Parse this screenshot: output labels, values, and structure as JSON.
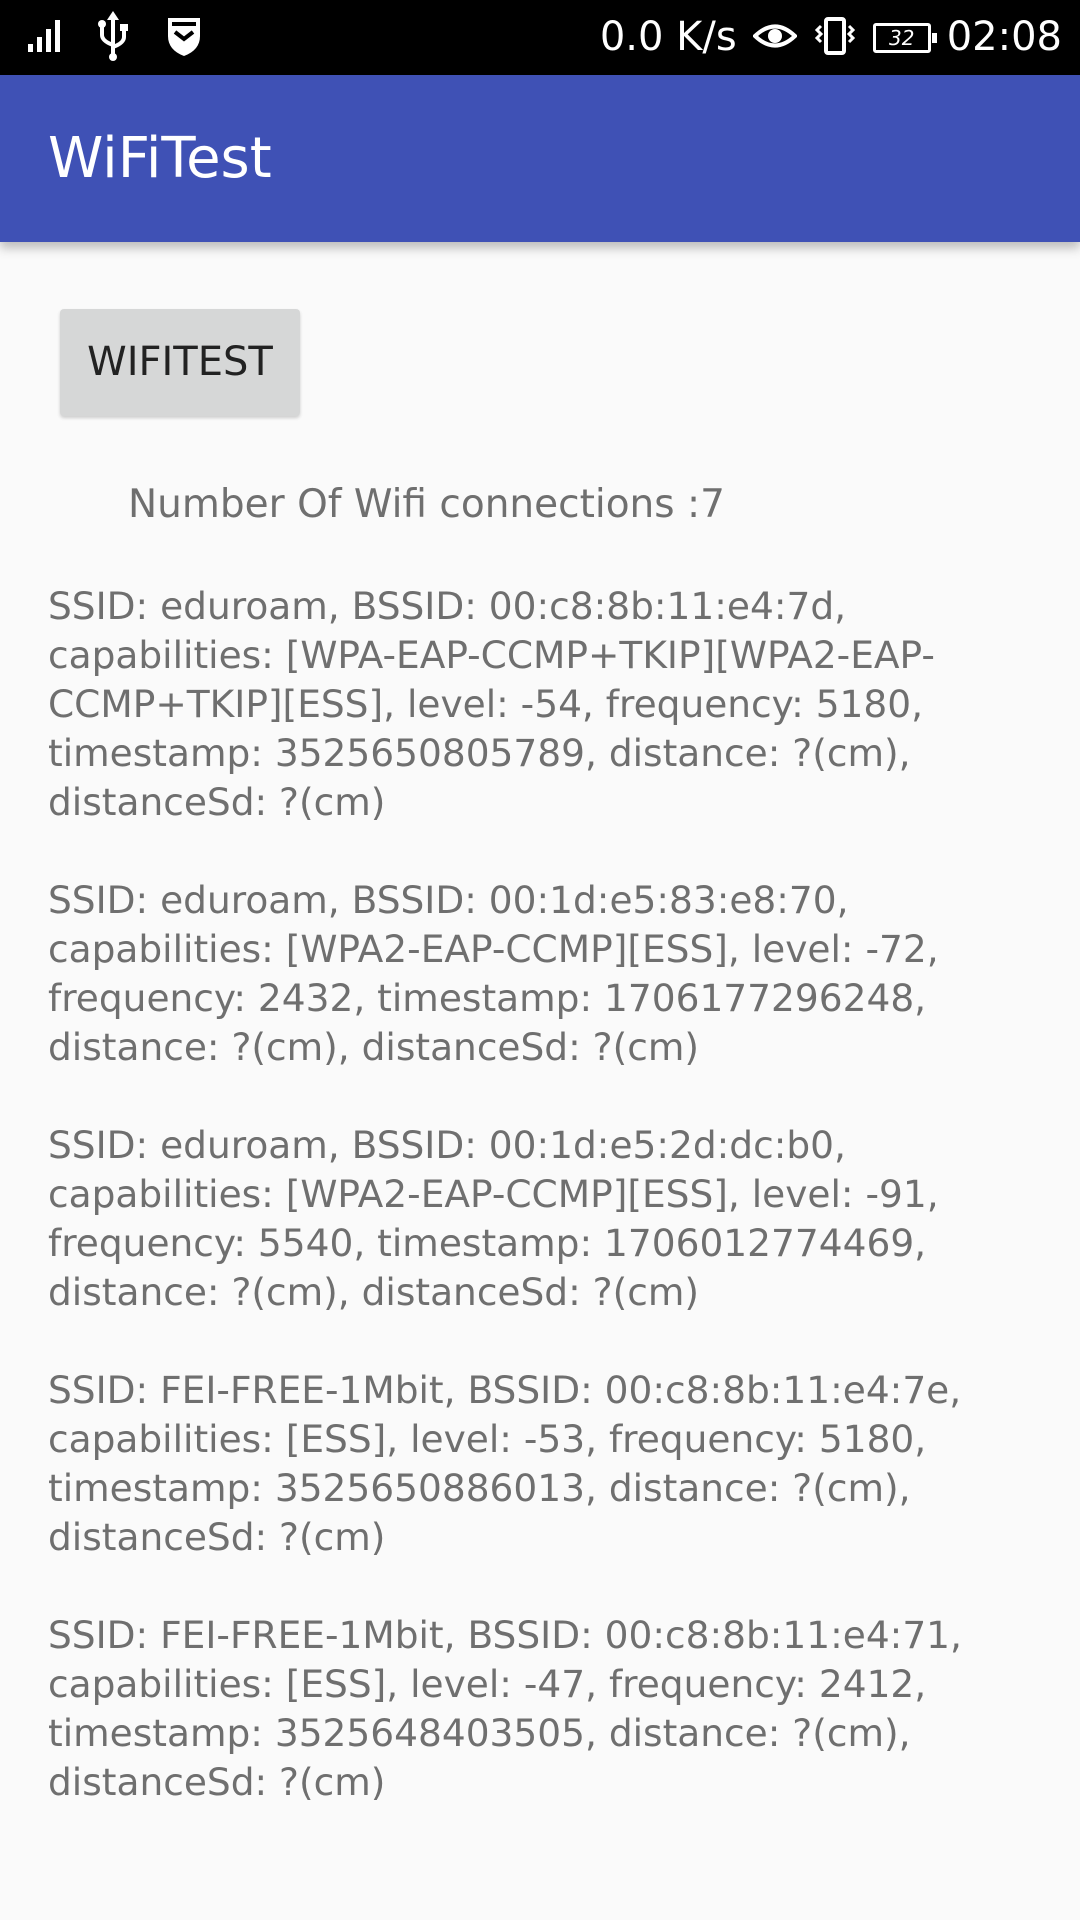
{
  "status_bar": {
    "network_speed": "0.0 K/s",
    "battery_level": "32",
    "time": "02:08",
    "icons": [
      "signal-icon",
      "usb-icon",
      "shield-icon",
      "eye-icon",
      "vibrate-icon",
      "battery-icon"
    ]
  },
  "app_bar": {
    "title": "WiFiTest",
    "color": "#3f51b5"
  },
  "main": {
    "button_label": "WIFITEST",
    "count_label": "Number Of Wifi connections :7",
    "results": [
      "SSID: eduroam, BSSID: 00:c8:8b:11:e4:7d,\ncapabilities: [WPA-EAP-CCMP+TKIP][WPA2-EAP-\nCCMP+TKIP][ESS], level: -54, frequency: 5180,\ntimestamp: 3525650805789, distance: ?(cm),\ndistanceSd: ?(cm)",
      "SSID: eduroam, BSSID: 00:1d:e5:83:e8:70,\ncapabilities: [WPA2-EAP-CCMP][ESS], level: -72,\nfrequency: 2432, timestamp: 1706177296248,\ndistance: ?(cm), distanceSd: ?(cm)",
      "SSID: eduroam, BSSID: 00:1d:e5:2d:dc:b0,\ncapabilities: [WPA2-EAP-CCMP][ESS], level: -91,\nfrequency: 5540, timestamp: 1706012774469,\ndistance: ?(cm), distanceSd: ?(cm)",
      "SSID: FEI-FREE-1Mbit, BSSID: 00:c8:8b:11:e4:7e,\ncapabilities: [ESS], level: -53, frequency: 5180,\ntimestamp: 3525650886013, distance: ?(cm),\ndistanceSd: ?(cm)",
      "SSID: FEI-FREE-1Mbit, BSSID: 00:c8:8b:11:e4:71,\ncapabilities: [ESS], level: -47, frequency: 2412,\ntimestamp: 3525648403505, distance: ?(cm),\ndistanceSd: ?(cm)"
    ]
  }
}
